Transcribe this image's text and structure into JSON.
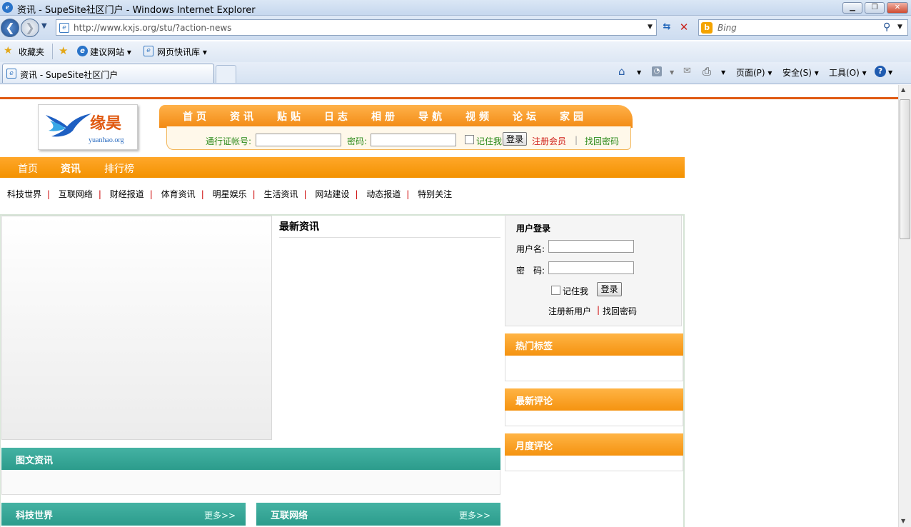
{
  "window": {
    "title": "资讯 - SupeSite社区门户 - Windows Internet Explorer"
  },
  "address": {
    "url": "http://www.kxjs.org/stu/?action-news"
  },
  "search": {
    "placeholder": "Bing"
  },
  "favorites": {
    "fav_label": "收藏夹",
    "suggested": "建议网站 ▾",
    "webslice": "网页快讯库 ▾"
  },
  "tab": {
    "title": "资讯 - SupeSite社区门户"
  },
  "commandbar": {
    "page": "页面(P) ▾",
    "safety": "安全(S) ▾",
    "tools": "工具(O) ▾",
    "help": "? ▾"
  },
  "logo": {
    "name": "缘昊",
    "domain": "yuanhao.org"
  },
  "topnav": [
    "首页",
    "资讯",
    "贴贴",
    "日志",
    "相册",
    "导航",
    "视频",
    "论坛",
    "家园"
  ],
  "toplogin": {
    "account_label": "通行证帐号:",
    "password_label": "密码:",
    "remember": "记住我",
    "login": "登录",
    "register": "注册会员",
    "sep": "|",
    "forgot": "找回密码"
  },
  "mainnav": [
    "首页",
    "资讯",
    "排行榜"
  ],
  "categories": [
    "科技世界",
    "互联网络",
    "财经报道",
    "体育资讯",
    "明星娱乐",
    "生活资讯",
    "网站建设",
    "动态报道",
    "特别关注"
  ],
  "latest": {
    "title": "最新资讯"
  },
  "tuwen": {
    "title": "图文资讯"
  },
  "sections": [
    {
      "title": "科技世界",
      "more": "更多>>"
    },
    {
      "title": "互联网络",
      "more": "更多>>"
    }
  ],
  "userlogin": {
    "title": "用户登录",
    "username": "用户名:",
    "password": "密　码:",
    "remember": "记住我",
    "login": "登录",
    "register": "注册新用户",
    "sep": "|",
    "forgot": "找回密码"
  },
  "side": {
    "hot_tags": "热门标签",
    "latest_comments": "最新评论",
    "month_comments": "月度评论"
  }
}
